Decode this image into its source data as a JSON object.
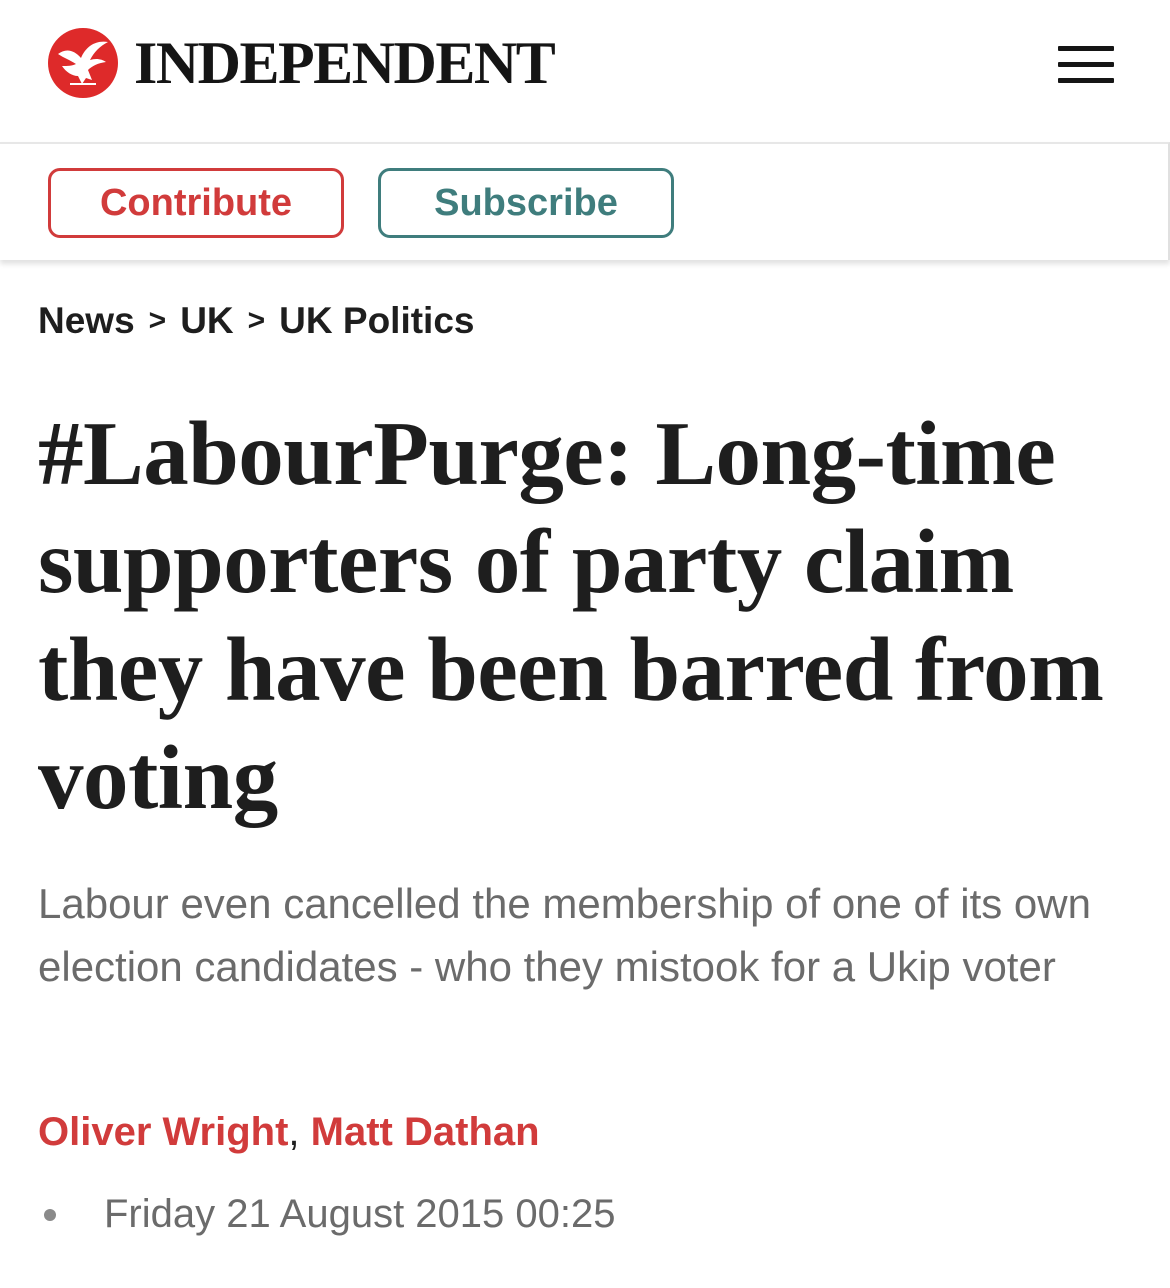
{
  "header": {
    "brand": "INDEPENDENT",
    "logo_icon": "eagle-icon",
    "menu_icon": "hamburger-menu-icon",
    "brand_color": "#de2a2a"
  },
  "actions": {
    "contribute_label": "Contribute",
    "subscribe_label": "Subscribe",
    "contribute_color": "#d13b3b",
    "subscribe_color": "#3f7d7d"
  },
  "breadcrumb": {
    "items": [
      "News",
      "UK",
      "UK Politics"
    ],
    "separator": ">"
  },
  "article": {
    "headline": "#LabourPurge: Long-time supporters of party claim they have been barred from voting",
    "standfirst": "Labour even cancelled the membership of one of its own election candidates - who they mistook for a Ukip voter",
    "authors": [
      "Oliver Wright",
      "Matt Dathan"
    ],
    "author_separator": ",",
    "date": "Friday 21 August 2015 00:25"
  }
}
